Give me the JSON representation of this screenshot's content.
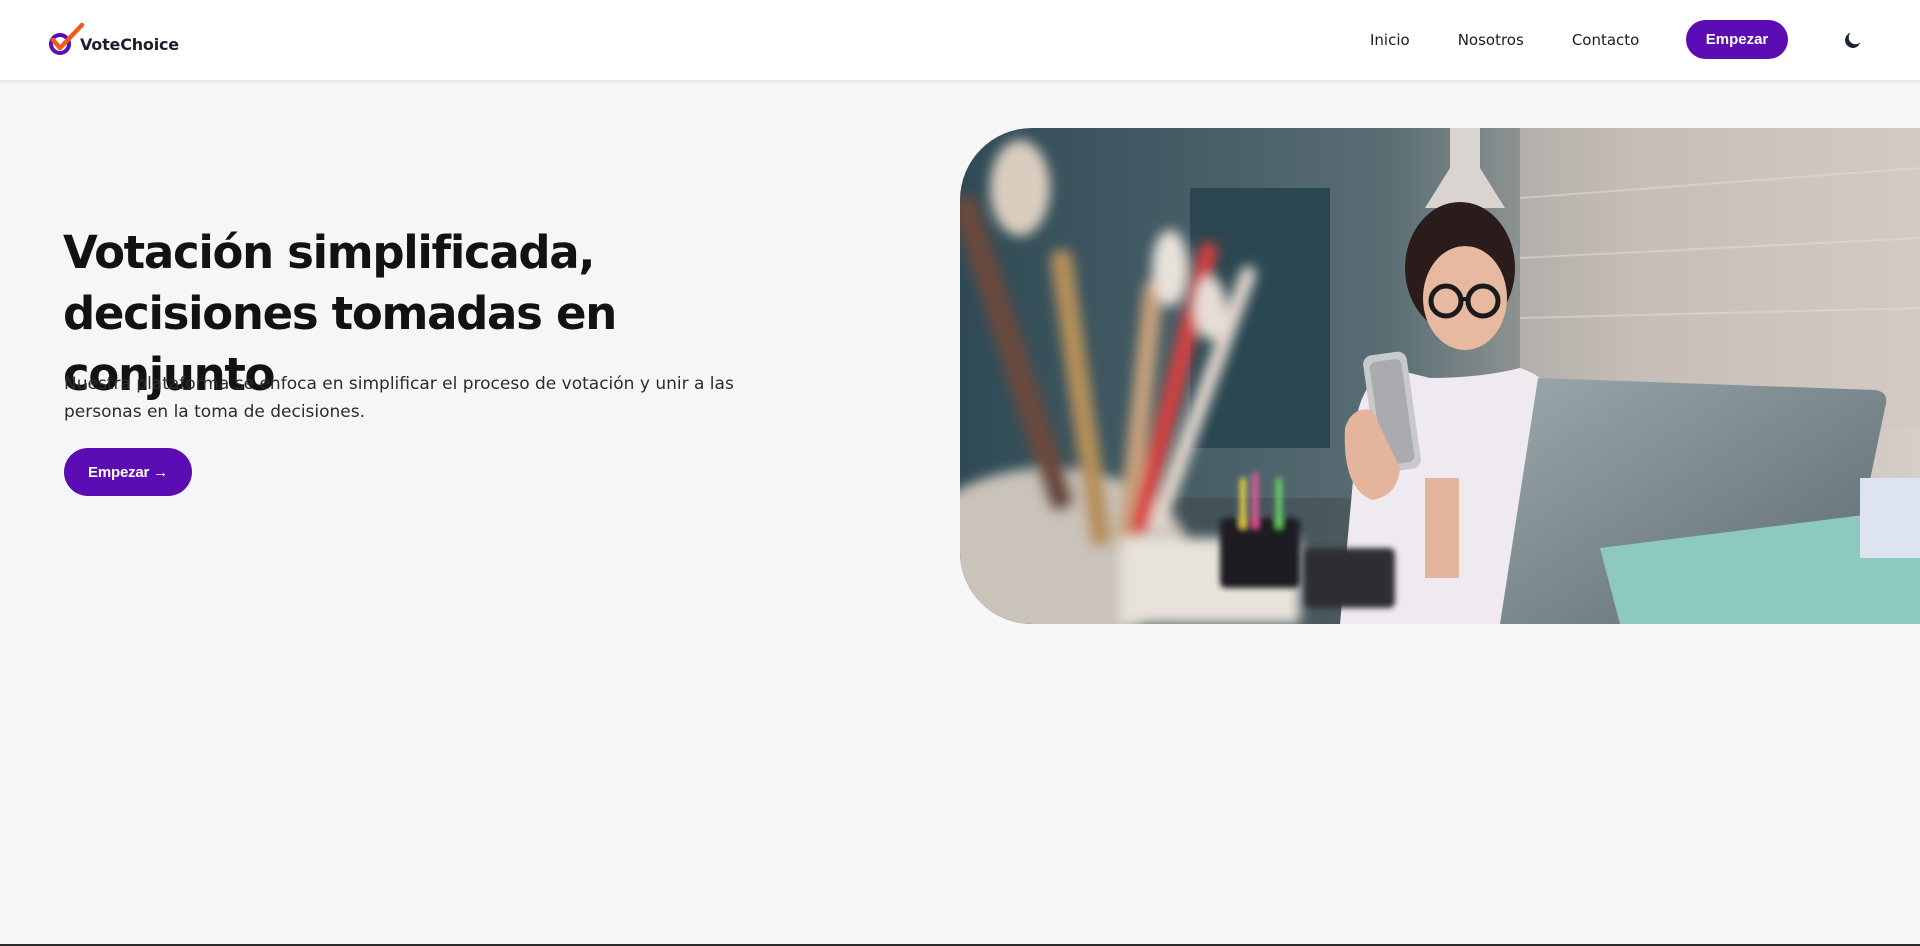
{
  "brand": {
    "name": "VoteChoice",
    "accent": "#5b0db3",
    "check_color": "#f05a1a"
  },
  "nav": {
    "links": [
      "Inicio",
      "Nosotros",
      "Contacto"
    ],
    "cta_label": "Empezar",
    "theme_icon": "moon-icon"
  },
  "hero": {
    "title": "Votación simplificada, decisiones tomadas en conjunto",
    "subtitle": "Nuestra plataforma se enfoca en simplificar el proceso de votación y unir a las personas en la toma de decisiones.",
    "cta_label": "Empezar →"
  }
}
